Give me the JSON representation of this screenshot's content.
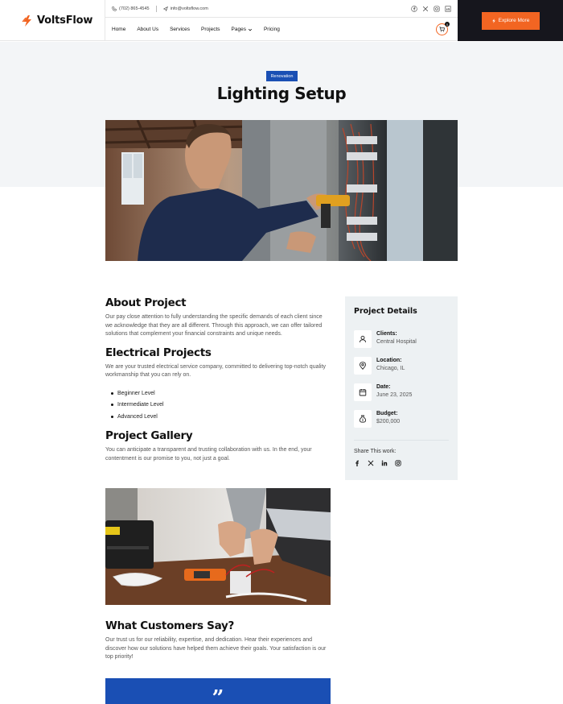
{
  "brand": {
    "name": "VoltsFlow",
    "accent": "#f26522",
    "blue": "#1a4fb4",
    "dark": "#16161d"
  },
  "topbar": {
    "phone": "(702) 865-4545",
    "email": "info@voltsflow.com",
    "socials": [
      "facebook-icon",
      "x-icon",
      "instagram-icon",
      "linkedin-icon"
    ]
  },
  "nav": {
    "items": [
      {
        "label": "Home"
      },
      {
        "label": "About Us"
      },
      {
        "label": "Services"
      },
      {
        "label": "Projects"
      },
      {
        "label": "Pages"
      },
      {
        "label": "Pricing"
      }
    ],
    "cart_count": "0",
    "cta_label": "Explore More"
  },
  "hero": {
    "tag": "Renovation",
    "title": "Lighting Setup"
  },
  "main": {
    "about": {
      "heading": "About Project",
      "body": "Our pay close attention to fully understanding the specific demands of each client since we acknowledge that they are all different. Through this approach, we can offer tailored solutions that complement your financial constraints and unique needs."
    },
    "electrical": {
      "heading": "Electrical Projects",
      "body": "We are your trusted electrical service company, committed to delivering top-notch quality workmanship that you can rely on.",
      "levels": [
        "Beginner Level",
        "Intermediate Level",
        "Advanced Level"
      ]
    },
    "gallery": {
      "heading": "Project Gallery",
      "body": "You can anticipate a transparent and trusting collaboration with us. In the end, your contentment is our promise to you, not just a goal."
    },
    "customers": {
      "heading": "What Customers Say?",
      "body": "Our trust us for our reliability, expertise, and dedication. Hear their experiences and discover how our solutions have helped them achieve their goals. Your satisfaction is our top priority!",
      "quote_mark": "”"
    }
  },
  "sidebar": {
    "title": "Project Details",
    "details": [
      {
        "label": "Clients:",
        "value": "Central Hospital",
        "icon": "user-icon"
      },
      {
        "label": "Location:",
        "value": "Chicago, IL",
        "icon": "location-pin-icon"
      },
      {
        "label": "Date:",
        "value": "June 23, 2025",
        "icon": "calendar-icon"
      },
      {
        "label": "Budget:",
        "value": "$200,000",
        "icon": "money-bag-icon"
      }
    ],
    "share_label": "Share This work:",
    "share_icons": [
      "facebook-icon",
      "x-icon",
      "linkedin-icon",
      "instagram-icon"
    ]
  }
}
